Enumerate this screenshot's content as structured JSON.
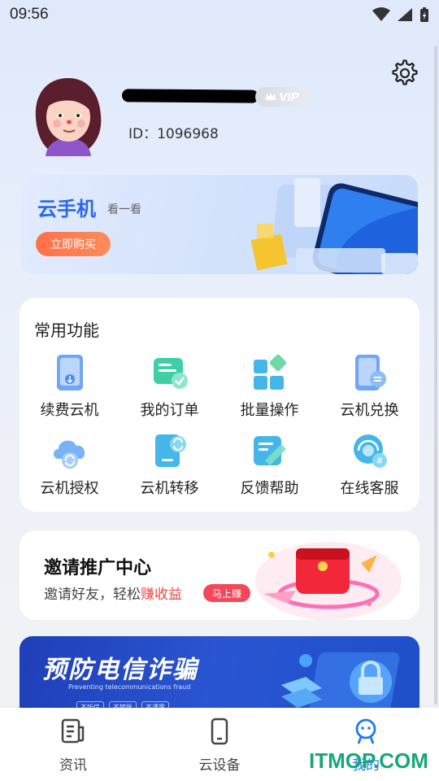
{
  "status_bar": {
    "time": "09:56"
  },
  "profile": {
    "vip_label": "VIP",
    "id_text": "ID：1096968"
  },
  "banner": {
    "title": "云手机",
    "subtitle": "看一看",
    "button": "立即购买"
  },
  "functions": {
    "title": "常用功能",
    "items": [
      {
        "label": "续费云机",
        "icon": "renew-phone-icon"
      },
      {
        "label": "我的订单",
        "icon": "order-icon"
      },
      {
        "label": "批量操作",
        "icon": "batch-icon"
      },
      {
        "label": "云机兑换",
        "icon": "exchange-icon"
      },
      {
        "label": "云机授权",
        "icon": "authorize-icon"
      },
      {
        "label": "云机转移",
        "icon": "transfer-icon"
      },
      {
        "label": "反馈帮助",
        "icon": "feedback-icon"
      },
      {
        "label": "在线客服",
        "icon": "support-icon"
      }
    ]
  },
  "invite": {
    "title": "邀请推广中心",
    "sub_prefix": "邀请好友，轻松",
    "sub_highlight": "赚收益",
    "tag": "马上赚"
  },
  "fraud": {
    "title": "预防电信诈骗",
    "subtitle": "Preventing telecommunications fraud",
    "tags": [
      "不听信",
      "不转账",
      "不透露"
    ]
  },
  "tabs": [
    {
      "label": "资讯",
      "icon": "news-icon"
    },
    {
      "label": "云设备",
      "icon": "device-icon"
    },
    {
      "label": "我的",
      "icon": "profile-icon"
    }
  ],
  "watermark": "ITMOP.COM",
  "colors": {
    "accent": "#1e7ce8",
    "banner_title": "#2b67e8",
    "buy_button": "#ff6f4a",
    "highlight": "#f04747"
  }
}
